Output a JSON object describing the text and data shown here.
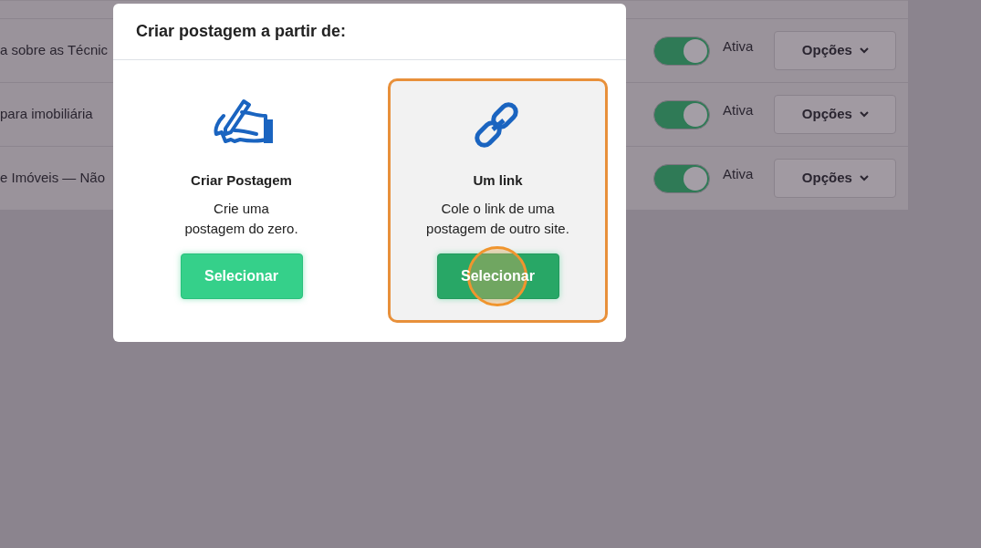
{
  "rows": [
    {
      "title": "a sobre as Técnic",
      "on": true,
      "status": "Ativa",
      "button": "Opções"
    },
    {
      "title": "para imobiliária",
      "on": true,
      "status": "Ativa",
      "button": "Opções"
    },
    {
      "title": "e Imóveis — Não",
      "on": true,
      "status": "Ativa",
      "button": "Opções"
    }
  ],
  "modal": {
    "title": "Criar postagem a partir de:",
    "options": [
      {
        "kind": "pen",
        "title": "Criar Postagem",
        "description": [
          "Crie uma",
          "postagem do zero."
        ],
        "button": "Selecionar",
        "selected": false,
        "clicked": false
      },
      {
        "kind": "link",
        "title": "Um link",
        "description": [
          "Cole o link de uma",
          "postagem de outro site."
        ],
        "button": "Selecionar",
        "selected": true,
        "clicked": true
      }
    ]
  }
}
